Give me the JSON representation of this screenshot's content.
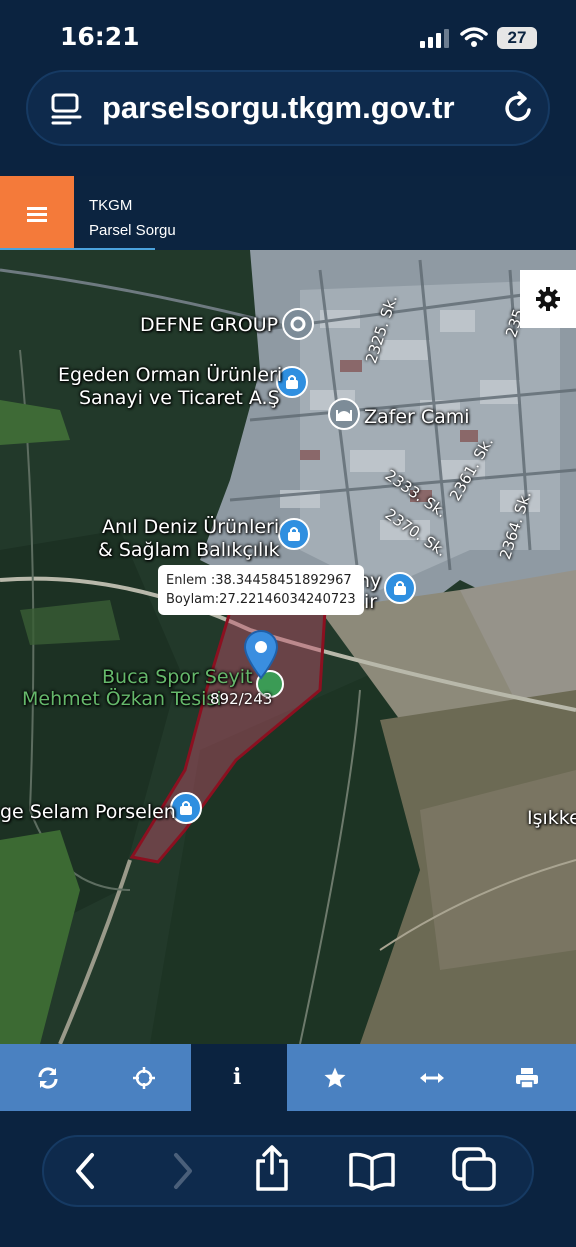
{
  "status_bar": {
    "time": "16:21",
    "battery": "27"
  },
  "browser": {
    "url": "parselsorgu.tkgm.gov.tr"
  },
  "app": {
    "title": "TKGM",
    "subtitle": "Parsel Sorgu"
  },
  "map": {
    "labels": {
      "defne": "DEFNE GROUP",
      "egeden_1": "Egeden Orman Ürünleri",
      "egeden_2": "Sanayi ve Ticaret A.Ş",
      "zafer": "Zafer Cami",
      "anil_1": "Anıl Deniz Ürünleri",
      "anil_2": "& Sağlam Balıkçılık",
      "partial_1": "ny",
      "partial_2": "ir",
      "buca_1": "Buca Spor Seyit",
      "buca_2": "Mehmet Özkan Tesisi",
      "selam": "ge Selam Porselen",
      "isik": "Işıkke"
    },
    "roads": {
      "r2325": "2325. Sk.",
      "r2333": "2333. Sk.",
      "r2361": "2361. Sk.",
      "r2370": "2370. Sk.",
      "r2364": "2364. Sk.",
      "r235": "235"
    },
    "popup": {
      "lat_line": "Enlem  :38.34458451892967",
      "lon_line": "Boylam:27.22146034240723"
    },
    "parcel_number": "892/243",
    "colors": {
      "parcel_outline": "#8b1020",
      "parcel_fill": "#c2506a",
      "pin": "#3a8ee0"
    }
  },
  "toolbar": {
    "items": [
      {
        "icon": "refresh-icon",
        "active": false
      },
      {
        "icon": "locate-icon",
        "active": false
      },
      {
        "icon": "info-icon",
        "active": true
      },
      {
        "icon": "star-icon",
        "active": false
      },
      {
        "icon": "measure-icon",
        "active": false
      },
      {
        "icon": "print-icon",
        "active": false
      }
    ],
    "info_glyph": "i",
    "colors": {
      "bar": "#4a81c1",
      "active": "#0b2340"
    }
  },
  "safari": {
    "buttons": [
      "back-icon",
      "forward-icon",
      "share-icon",
      "bookmarks-icon",
      "tabs-icon"
    ]
  }
}
